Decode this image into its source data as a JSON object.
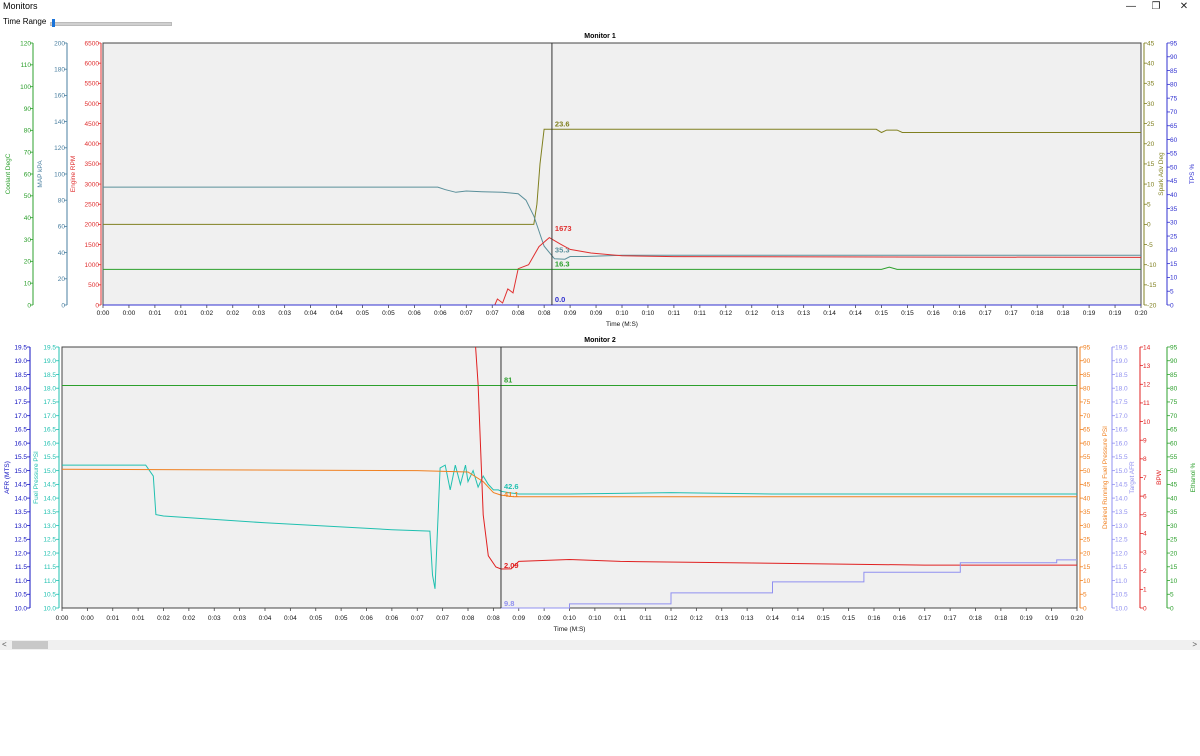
{
  "window": {
    "title": "Monitors",
    "min_glyph": "—",
    "max_glyph": "❐",
    "close_glyph": "✕"
  },
  "toolbar": {
    "time_range_label": "Time Range",
    "slider_value": 0.02
  },
  "scrollbar": {
    "left_glyph": "<",
    "right_glyph": ">",
    "thumb_fraction": 0.03
  },
  "chart_data": [
    {
      "type": "line",
      "title": "Monitor 1",
      "xlabel": "Time (M:S)",
      "x_ticks": [
        "0:00",
        "0:00",
        "0:01",
        "0:01",
        "0:02",
        "0:02",
        "0:03",
        "0:03",
        "0:04",
        "0:04",
        "0:05",
        "0:05",
        "0:06",
        "0:06",
        "0:07",
        "0:07",
        "0:08",
        "0:08",
        "0:09",
        "0:09",
        "0:10",
        "0:10",
        "0:11",
        "0:11",
        "0:12",
        "0:12",
        "0:13",
        "0:13",
        "0:14",
        "0:14",
        "0:15",
        "0:15",
        "0:16",
        "0:16",
        "0:17",
        "0:17",
        "0:18",
        "0:18",
        "0:19",
        "0:19",
        "0:20"
      ],
      "xlim": [
        0,
        20
      ],
      "cursor_x": 8.65,
      "grid": false,
      "axes": [
        {
          "id": "coolant",
          "label": "Coolant DegC",
          "side": "left",
          "color": "#2ca02c",
          "min": 0,
          "max": 120,
          "step": 10
        },
        {
          "id": "map",
          "label": "MAP kPA",
          "side": "left",
          "color": "#4a7fa0",
          "min": 0,
          "max": 200,
          "step": 20
        },
        {
          "id": "rpm",
          "label": "Engine RPM",
          "side": "left",
          "color": "#e03030",
          "min": 0,
          "max": 6500,
          "step": 500
        },
        {
          "id": "spark",
          "label": "Spark Adv Deg",
          "side": "right",
          "color": "#808020",
          "min": -20,
          "max": 45,
          "step": 5
        },
        {
          "id": "tps",
          "label": "TPS %",
          "side": "right",
          "color": "#3030d0",
          "min": 0,
          "max": 95,
          "step": 5
        }
      ],
      "series": [
        {
          "axis": "spark",
          "color": "#808020",
          "x": [
            0,
            8.3,
            8.36,
            8.42,
            8.5,
            14.9,
            15.0,
            15.1,
            15.3,
            15.4,
            20
          ],
          "y": [
            0,
            0,
            5,
            15,
            23.6,
            23.6,
            22.8,
            23.4,
            23.4,
            22.8,
            22.8
          ],
          "label": "23.6"
        },
        {
          "axis": "map",
          "color": "#5a8f9a",
          "x": [
            0,
            6.45,
            6.6,
            6.8,
            7.0,
            7.3,
            7.7,
            8.0,
            8.15,
            8.3,
            8.5,
            8.7,
            8.9,
            9.0,
            9.3,
            10.0,
            20
          ],
          "y": [
            90,
            90,
            88,
            86,
            87,
            86.5,
            86,
            85,
            80,
            68,
            45,
            35.3,
            35,
            37,
            37,
            38,
            38
          ],
          "label": "35.3"
        },
        {
          "axis": "rpm",
          "color": "#e03030",
          "x": [
            7.3,
            7.55,
            7.6,
            7.7,
            7.8,
            7.9,
            8.0,
            8.2,
            8.4,
            8.6,
            8.8,
            9.0,
            9.4,
            10.0,
            11.0,
            20
          ],
          "y": [
            0,
            0,
            150,
            50,
            400,
            300,
            900,
            1000,
            1450,
            1673,
            1520,
            1380,
            1290,
            1220,
            1200,
            1180
          ],
          "label": "1673"
        },
        {
          "axis": "coolant",
          "color": "#2ca02c",
          "x": [
            0,
            8.5,
            8.65,
            15.0,
            15.15,
            15.3,
            20
          ],
          "y": [
            16.3,
            16.3,
            16.3,
            16.3,
            17.3,
            16.3,
            16.3
          ],
          "label": "16.3"
        },
        {
          "axis": "tps",
          "color": "#3030d0",
          "x": [
            0,
            20
          ],
          "y": [
            0,
            0
          ],
          "label": "0.0"
        }
      ]
    },
    {
      "type": "line",
      "title": "Monitor 2",
      "xlabel": "Time (M:S)",
      "x_ticks": [
        "0:00",
        "0:00",
        "0:01",
        "0:01",
        "0:02",
        "0:02",
        "0:03",
        "0:03",
        "0:04",
        "0:04",
        "0:05",
        "0:05",
        "0:06",
        "0:06",
        "0:07",
        "0:07",
        "0:08",
        "0:08",
        "0:09",
        "0:09",
        "0:10",
        "0:10",
        "0:11",
        "0:11",
        "0:12",
        "0:12",
        "0:13",
        "0:13",
        "0:14",
        "0:14",
        "0:15",
        "0:15",
        "0:16",
        "0:16",
        "0:17",
        "0:17",
        "0:18",
        "0:18",
        "0:19",
        "0:19",
        "0:20"
      ],
      "xlim": [
        0,
        20
      ],
      "cursor_x": 8.65,
      "grid": false,
      "axes": [
        {
          "id": "afr",
          "label": "AFR (MTS)",
          "side": "left",
          "color": "#1010c0",
          "min": 10.0,
          "max": 19.5,
          "step": 0.5,
          "decimals": 1
        },
        {
          "id": "fuelp",
          "label": "Fuel Pressure PSI",
          "side": "left",
          "color": "#20c0b0",
          "min": 10.0,
          "max": 19.5,
          "step": 0.5,
          "decimals": 1
        },
        {
          "id": "drfp",
          "label": "Desired Running Fuel Pressure PSI",
          "side": "right",
          "color": "#f08020",
          "min": 0,
          "max": 95,
          "step": 5
        },
        {
          "id": "tafr",
          "label": "Target AFR",
          "side": "right",
          "color": "#9090f0",
          "min": 10.0,
          "max": 19.5,
          "step": 0.5,
          "decimals": 1
        },
        {
          "id": "bpw",
          "label": "BPW",
          "side": "right",
          "color": "#e02020",
          "min": 0,
          "max": 14,
          "step": 1
        },
        {
          "id": "eth",
          "label": "Ethanol %",
          "side": "right",
          "color": "#2ca02c",
          "min": 0,
          "max": 95,
          "step": 5
        }
      ],
      "series": [
        {
          "axis": "fuelp",
          "color": "#20c0b0",
          "x": [
            0,
            1.65,
            1.8,
            1.85,
            2.0,
            4.0,
            6.5,
            7.25,
            7.3,
            7.35,
            7.45,
            7.55,
            7.65,
            7.75,
            7.85,
            7.95,
            8.0,
            8.1,
            8.2,
            8.3,
            8.4,
            8.5,
            8.6,
            8.65,
            8.8,
            9.0,
            10,
            12,
            14,
            16,
            18,
            20
          ],
          "y": [
            15.2,
            15.2,
            14.8,
            13.4,
            13.35,
            13.1,
            12.85,
            12.8,
            11.2,
            10.7,
            15.1,
            15.2,
            14.3,
            15.2,
            14.5,
            15.2,
            14.6,
            15.0,
            14.4,
            14.8,
            14.5,
            14.3,
            14.3,
            14.25,
            14.2,
            14.15,
            14.15,
            14.2,
            14.15,
            14.15,
            14.15,
            14.15
          ],
          "label": "42.6"
        },
        {
          "axis": "drfp",
          "color": "#f08020",
          "x": [
            0,
            7.0,
            8.0,
            8.3,
            8.5,
            8.65,
            8.9,
            9.0,
            20
          ],
          "y": [
            50.5,
            50,
            49.5,
            46,
            42,
            41.1,
            40.5,
            40.5,
            40.5
          ],
          "label": "41.1"
        },
        {
          "axis": "bpw",
          "color": "#e02020",
          "x": [
            8.15,
            8.2,
            8.3,
            8.4,
            8.55,
            8.65,
            8.85,
            9.0,
            10.0,
            11.0,
            14.0,
            17.0,
            20
          ],
          "y": [
            14.8,
            12,
            5,
            2.8,
            2.2,
            2.09,
            2.1,
            2.5,
            2.6,
            2.5,
            2.4,
            2.3,
            2.3
          ],
          "label": "2.09"
        },
        {
          "axis": "tafr",
          "color": "#9090f0",
          "x": [
            8.65,
            10.0,
            10.0,
            12.0,
            12.0,
            14.0,
            14.0,
            15.8,
            15.8,
            17.7,
            17.7,
            19.6,
            19.6,
            20
          ],
          "y": [
            10.0,
            10.0,
            10.15,
            10.15,
            10.55,
            10.55,
            10.95,
            10.95,
            11.3,
            11.3,
            11.65,
            11.65,
            11.75,
            11.75
          ],
          "label": "9.8"
        },
        {
          "axis": "eth",
          "color": "#2ca02c",
          "x": [
            0,
            20
          ],
          "y": [
            81,
            81
          ],
          "label": "81"
        }
      ]
    }
  ]
}
